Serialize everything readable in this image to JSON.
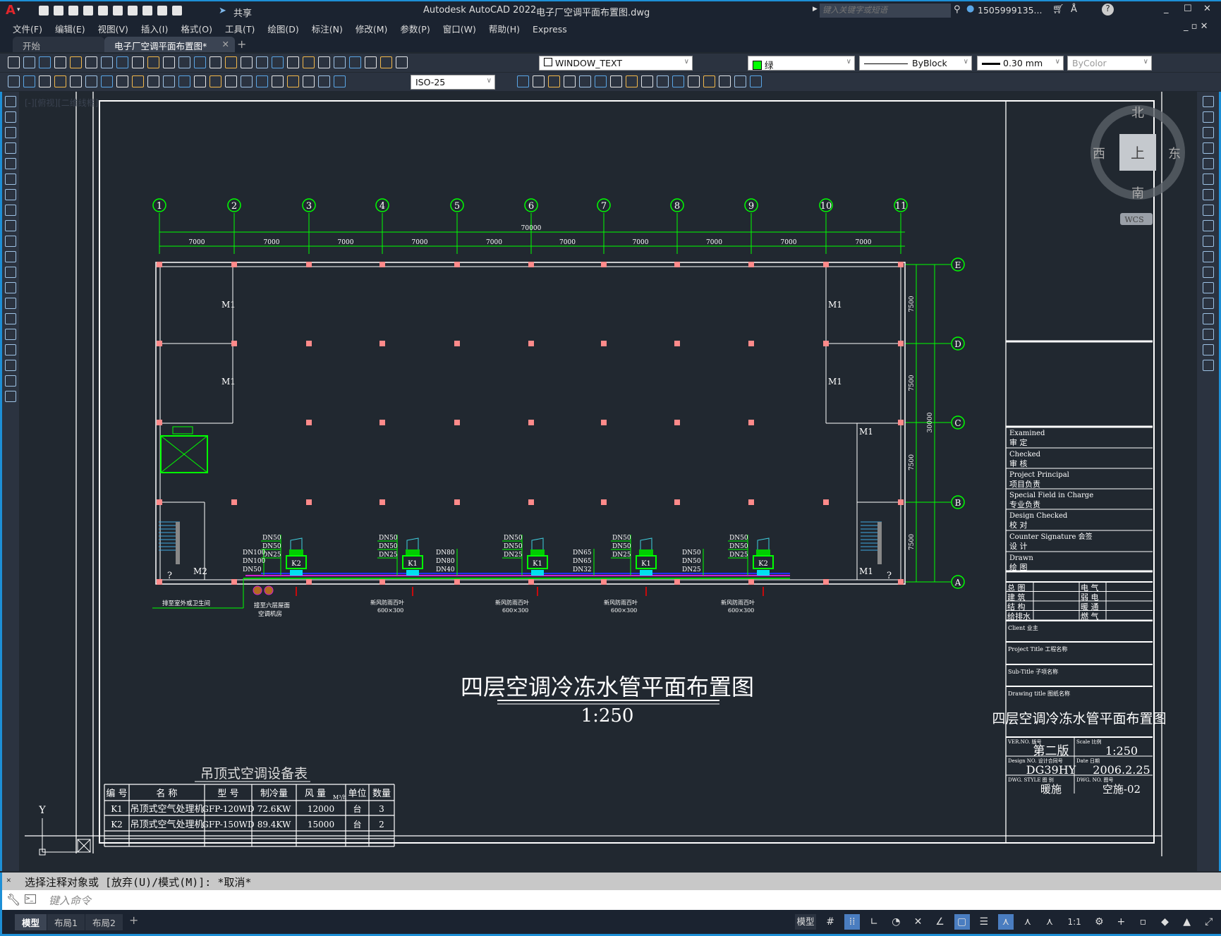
{
  "app": {
    "title": "Autodesk AutoCAD 2022",
    "filename": "电子厂空调平面布置图.dwg",
    "share_label": "共享",
    "search_placeholder": "键入关键字或短语",
    "user": "1505999135...",
    "logo": "A"
  },
  "menu": [
    "文件(F)",
    "编辑(E)",
    "视图(V)",
    "插入(I)",
    "格式(O)",
    "工具(T)",
    "绘图(D)",
    "标注(N)",
    "修改(M)",
    "参数(P)",
    "窗口(W)",
    "帮助(H)",
    "Express"
  ],
  "doc_tabs": [
    {
      "label": "开始",
      "active": false
    },
    {
      "label": "电子厂空调平面布置图*",
      "active": true
    }
  ],
  "toolbar": {
    "layer": "WINDOW_TEXT",
    "color_name": "绿",
    "color": "#00ff00",
    "linetype": "ByBlock",
    "lineweight": "0.30 mm",
    "plotstyle": "ByColor",
    "dimstyle": "ISO-25",
    "row1_icons": [
      "new",
      "open",
      "save",
      "plot",
      "plot-preview",
      "publish",
      "3d-print",
      "cut",
      "copy",
      "paste",
      "match-properties",
      "block-editor",
      "undo",
      "redo",
      "pan",
      "zoom-realtime",
      "zoom-window",
      "zoom-previous",
      "properties",
      "design-center",
      "tool-palettes",
      "sheet-set",
      "markup",
      "quickcalc",
      "help",
      "layer-manager"
    ],
    "row2_icons": [
      "edit-attribute",
      "batch-check",
      "layer-off",
      "linear-dim",
      "aligned-dim",
      "arc-length",
      "ordinate-dim",
      "radius-dim",
      "diameter-dim",
      "angular-dim",
      "quick-dim",
      "baseline-dim",
      "continue-dim",
      "dim-space",
      "dim-break",
      "tolerance",
      "center-mark",
      "inspect",
      "jogged-linear",
      "dim-edit",
      "dim-text-edit",
      "dim-update"
    ],
    "row2b_icons": [
      "copy-object",
      "erase",
      "rotate-3d",
      "mirror",
      "stretch",
      "scale",
      "array",
      "offset",
      "fillet",
      "chamfer",
      "explode",
      "insert",
      "purge",
      "align",
      "group",
      "audit"
    ]
  },
  "viewport_label": "[-][俯视][二维线框]",
  "viewcube": {
    "north": "北",
    "south": "南",
    "east": "东",
    "west": "西",
    "top": "上",
    "wcs": "WCS"
  },
  "drawing": {
    "grid_x": [
      "1",
      "2",
      "3",
      "4",
      "5",
      "6",
      "7",
      "8",
      "9",
      "10",
      "11"
    ],
    "grid_y": [
      "E",
      "D",
      "C",
      "B",
      "A"
    ],
    "dim_total_x": "70000",
    "dim_x": [
      "7000",
      "7000",
      "7000",
      "7000",
      "7000",
      "7000",
      "7000",
      "7000",
      "7000",
      "7000"
    ],
    "dim_total_y": "30000",
    "dim_y": [
      "7500",
      "7500",
      "7500",
      "7500"
    ],
    "doors": [
      "M1",
      "M1",
      "M1",
      "M1",
      "M1",
      "M2",
      "M1"
    ],
    "units": [
      {
        "tag": "K2",
        "pipes": [
          "DN50",
          "DN50",
          "DN25"
        ]
      },
      {
        "tag": "K1",
        "pipes": [
          "DN50",
          "DN50",
          "DN25"
        ]
      },
      {
        "tag": "K1",
        "pipes": [
          "DN50",
          "DN50",
          "DN25"
        ]
      },
      {
        "tag": "K1",
        "pipes": [
          "DN50",
          "DN50",
          "DN25"
        ]
      },
      {
        "tag": "K2",
        "pipes": [
          "DN50",
          "DN50",
          "DN25"
        ]
      }
    ],
    "main_pipes": [
      [
        "DN100",
        "DN100",
        "DN50"
      ],
      [
        "DN80",
        "DN80",
        "DN40"
      ],
      [
        "DN65",
        "DN65",
        "DN32"
      ],
      [
        "DN50",
        "DN50",
        "DN25"
      ]
    ],
    "notes": {
      "drain": "排至室外或卫生间",
      "riser": "接至六层屋面",
      "riser2": "空调机房",
      "louver": "新风防雨百叶",
      "louver_size": "600×300",
      "question": "?"
    },
    "title": "四层空调冷冻水管平面布置图",
    "scale": "1:250",
    "ucs_y": "Y"
  },
  "equipment_table": {
    "title": "吊顶式空调设备表",
    "headers": [
      "编 号",
      "名 称",
      "型 号",
      "制冷量",
      "风 量",
      "单位",
      "数量"
    ],
    "unit_suffix": "M³/h",
    "rows": [
      [
        "K1",
        "吊顶式空气处理机",
        "GFP-120WD",
        "72.6KW",
        "12000",
        "台",
        "3"
      ],
      [
        "K2",
        "吊顶式空气处理机",
        "GFP-150WD",
        "89.4KW",
        "15000",
        "台",
        "2"
      ],
      [
        "",
        "",
        "",
        "",
        "",
        "",
        ""
      ]
    ]
  },
  "title_block": {
    "signatures": [
      [
        "Examined",
        "审  定"
      ],
      [
        "Checked",
        "审  核"
      ],
      [
        "Project Principal",
        "项目负责"
      ],
      [
        "Special Field in Charge",
        "专业负责"
      ],
      [
        "Design Checked",
        "校  对"
      ],
      [
        "Counter Signature  会签",
        "设  计"
      ],
      [
        "Drawn",
        "绘  图"
      ]
    ],
    "disciplines": [
      [
        "总  图",
        "电  气"
      ],
      [
        "建  筑",
        "弱  电"
      ],
      [
        "结  构",
        "暖  通"
      ],
      [
        "给排水",
        "燃  气"
      ]
    ],
    "client": "Client  业主",
    "project_title": "Project Title  工程名称",
    "sub_title": "Sub-Title  子项名称",
    "drawing_title_label": "Drawing title   图纸名称",
    "drawing_title": "四层空调冷冻水管平面布置图",
    "ver_label": "VER.NO. 版号",
    "ver": "第二版",
    "scale_label": "Scale 比例",
    "scale": "1:250",
    "design_no_label": "Design NO. 设计合同号",
    "design_no": "DG39HY",
    "date_label": "Date 日期",
    "date": "2006.2.25",
    "style_label": "DWG. STYLE 图 别",
    "style": "暖施",
    "dwg_no_label": "DWG. NO. 图号",
    "dwg_no": "空施-02"
  },
  "command": {
    "history": "选择注释对象或 [放弃(U)/模式(M)]: *取消*",
    "placeholder": "键入命令"
  },
  "layout_tabs": [
    "模型",
    "布局1",
    "布局2"
  ],
  "status": {
    "model": "模型",
    "scale": "1:1"
  }
}
